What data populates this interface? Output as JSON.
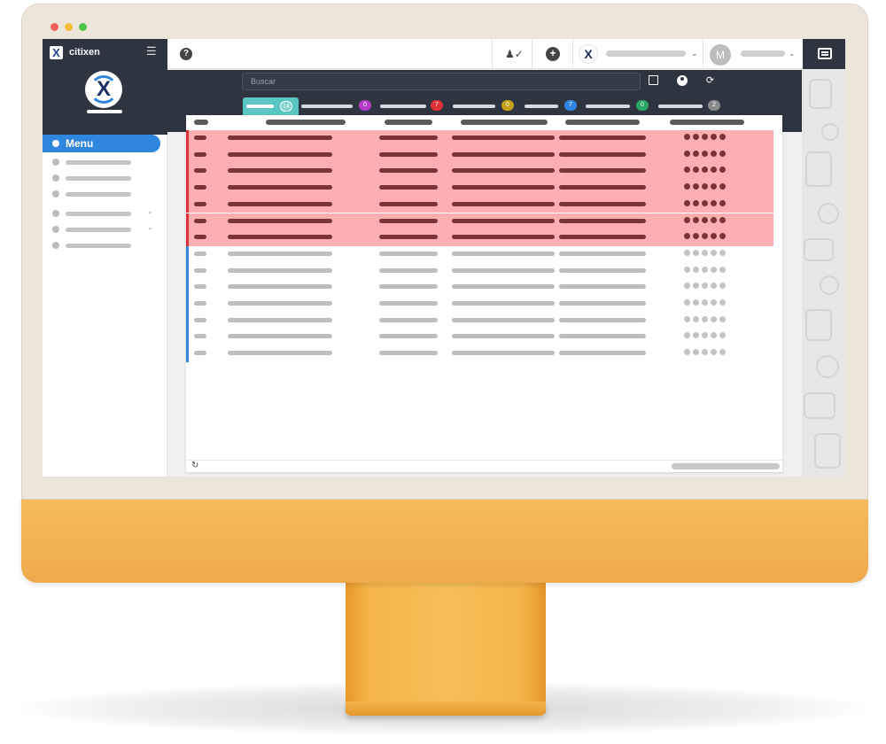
{
  "app": {
    "name": "citixen",
    "logo_letter": "X"
  },
  "sidebar": {
    "active_item": "Menu",
    "items": [
      {
        "expandable": false
      },
      {
        "expandable": false
      },
      {
        "expandable": false
      },
      {
        "expandable": true
      },
      {
        "expandable": true
      },
      {
        "expandable": false
      }
    ]
  },
  "topbar": {
    "user_initial": "M"
  },
  "toolbar": {
    "search_placeholder": "Buscar"
  },
  "tabs": [
    {
      "count": "14",
      "color": "#5ac6c1",
      "active": true
    },
    {
      "count": "0",
      "color": "#b23bc8",
      "active": false
    },
    {
      "count": "7",
      "color": "#e0303a",
      "active": false
    },
    {
      "count": "0",
      "color": "#c3a21a",
      "active": false
    },
    {
      "count": "7",
      "color": "#2f86de",
      "active": false
    },
    {
      "count": "0",
      "color": "#2aa766",
      "active": false
    },
    {
      "count": "2",
      "color": "#8a8a8a",
      "active": false
    }
  ],
  "table": {
    "column_count": 6,
    "highlighted_rows": 7,
    "normal_rows": 7,
    "rating_dots": 5
  },
  "colors": {
    "highlight_row": "#fdaeb2",
    "highlight_edge": "#e0303a",
    "normal_edge": "#2f86de",
    "accent": "#2f86de",
    "dark": "#2f3441",
    "device_orange": "#f2b254"
  }
}
